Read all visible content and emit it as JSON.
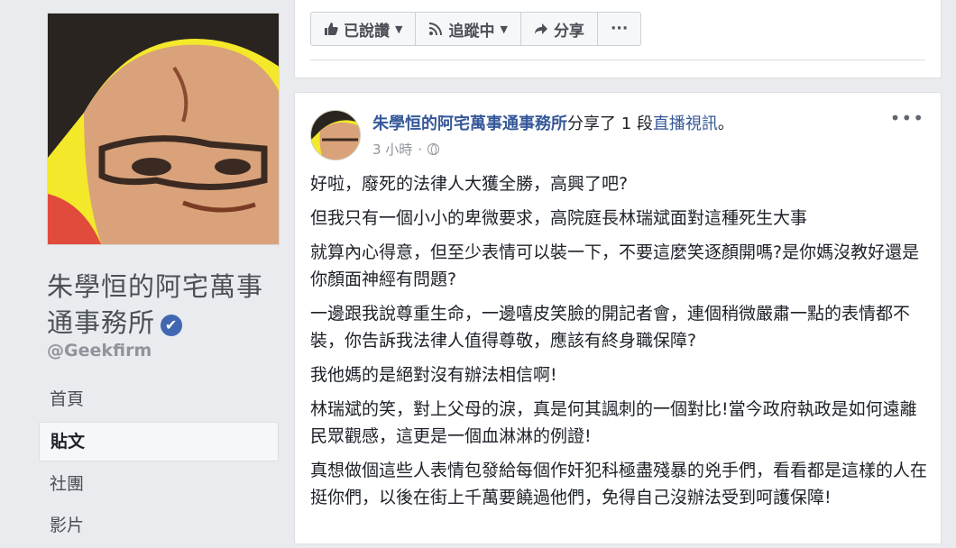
{
  "page": {
    "name": "朱學恒的阿宅萬事通事務所",
    "handle": "@Geekfirm",
    "verified_icon": "check-icon"
  },
  "nav": [
    {
      "label": "首頁",
      "active": false
    },
    {
      "label": "貼文",
      "active": true
    },
    {
      "label": "社團",
      "active": false
    },
    {
      "label": "影片",
      "active": false
    }
  ],
  "toolbar": {
    "like_label": "已說讚",
    "follow_label": "追蹤中",
    "share_label": "分享",
    "more_label": "···"
  },
  "post": {
    "author": "朱學恒的阿宅萬事通事務所",
    "action_text": "分享了 1 段",
    "link_text": "直播視訊",
    "after_text": "。",
    "time": "3 小時",
    "more_label": "•••",
    "paragraphs": [
      "好啦，廢死的法律人大獲全勝，高興了吧?",
      "但我只有一個小小的卑微要求，高院庭長林瑞斌面對這種死生大事",
      "就算內心得意，但至少表情可以裝一下，不要這麼笑逐顏開嗎?是你媽沒教好還是你顏面神經有問題?",
      "一邊跟我說尊重生命，一邊嘻皮笑臉的開記者會，連個稍微嚴肅一點的表情都不裝，你告訴我法律人值得尊敬，應該有終身職保障?",
      "我他媽的是絕對沒有辦法相信啊!",
      "林瑞斌的笑，對上父母的淚，真是何其諷刺的一個對比!當今政府執政是如何遠離民眾觀感，這更是一個血淋淋的例證!",
      "真想做個這些人表情包發給每個作奸犯科極盡殘暴的兇手們，看看都是這樣的人在挺你們，以後在街上千萬要饒過他們，免得自己沒辦法受到呵護保障!"
    ]
  },
  "colors": {
    "link": "#365899",
    "avatar_bg": "#f4e82a",
    "verified": "#4267b2"
  }
}
